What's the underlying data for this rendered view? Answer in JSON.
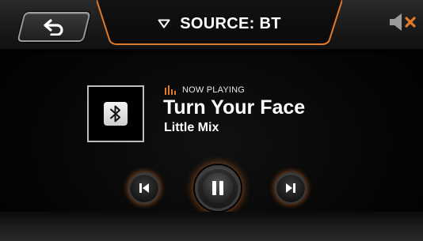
{
  "header": {
    "source_label": "SOURCE: BT"
  },
  "now_playing": {
    "indicator_label": "NOW PLAYING",
    "title": "Turn Your Face",
    "artist": "Little Mix"
  },
  "icons": {
    "back": "back-arrow-icon",
    "dropdown": "triangle-down-icon",
    "mute": "speaker-muted-icon",
    "album": "bluetooth-icon",
    "previous": "skip-previous-icon",
    "play_pause": "pause-icon",
    "next": "skip-next-icon"
  },
  "colors": {
    "accent": "#e07a28",
    "text": "#ffffff"
  }
}
